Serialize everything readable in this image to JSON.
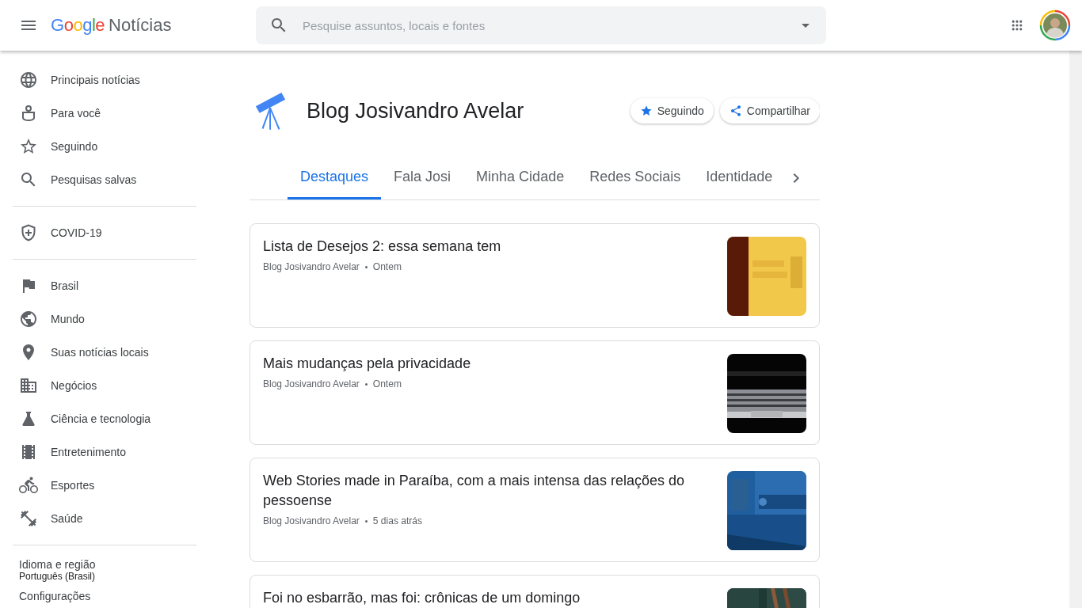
{
  "header": {
    "logo": {
      "brand": "Google",
      "product": "Notícias"
    },
    "search": {
      "placeholder": "Pesquise assuntos, locais e fontes"
    }
  },
  "sidebar": {
    "groups": [
      [
        {
          "label": "Principais notícias"
        },
        {
          "label": "Para você"
        },
        {
          "label": "Seguindo"
        },
        {
          "label": "Pesquisas salvas"
        }
      ],
      [
        {
          "label": "COVID-19"
        }
      ],
      [
        {
          "label": "Brasil"
        },
        {
          "label": "Mundo"
        },
        {
          "label": "Suas notícias locais"
        },
        {
          "label": "Negócios"
        },
        {
          "label": "Ciência e tecnologia"
        },
        {
          "label": "Entretenimento"
        },
        {
          "label": "Esportes"
        },
        {
          "label": "Saúde"
        }
      ]
    ],
    "footer": [
      {
        "label": "Idioma e região",
        "value": "Português (Brasil)"
      },
      {
        "label": "Configurações"
      }
    ]
  },
  "source": {
    "name": "Blog Josivandro Avelar",
    "follow_button": {
      "label": "Seguindo",
      "following": true
    },
    "share_button": {
      "label": "Compartilhar"
    }
  },
  "tabs": [
    {
      "label": "Destaques",
      "selected": true
    },
    {
      "label": "Fala Josi",
      "selected": false
    },
    {
      "label": "Minha Cidade",
      "selected": false
    },
    {
      "label": "Redes Sociais",
      "selected": false
    },
    {
      "label": "Identidade",
      "selected": false
    }
  ],
  "articles": [
    {
      "title": "Lista de Desejos 2: essa semana tem",
      "source": "Blog Josivandro Avelar",
      "time": "Ontem"
    },
    {
      "title": "Mais mudanças pela privacidade",
      "source": "Blog Josivandro Avelar",
      "time": "Ontem"
    },
    {
      "title": "Web Stories made in Paraíba, com a mais intensa das relações do pessoense",
      "source": "Blog Josivandro Avelar",
      "time": "5 dias atrás"
    },
    {
      "title": "Foi no esbarrão, mas foi: crônicas de um domingo"
    }
  ]
}
